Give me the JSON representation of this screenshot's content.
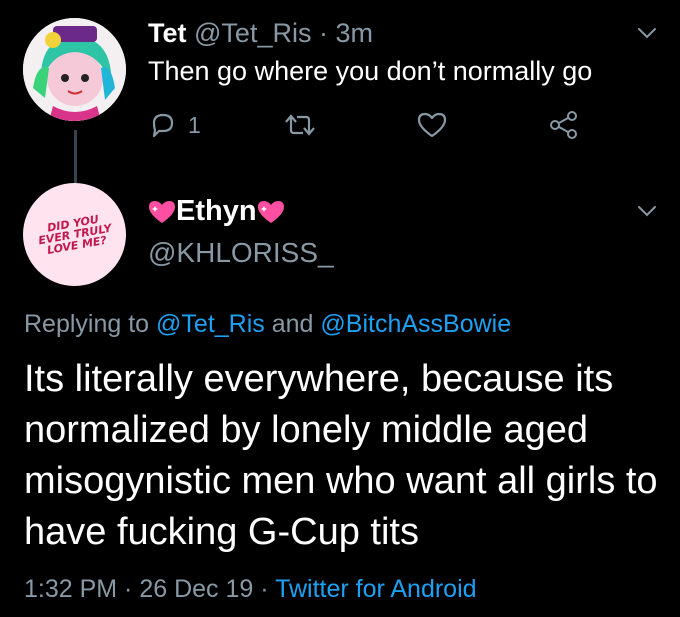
{
  "tweet1": {
    "name": "Tet",
    "handle": "@Tet_Ris",
    "separator": "·",
    "time": "3m",
    "text": "Then go where you don’t normally go",
    "reply_count": "1"
  },
  "tweet2": {
    "name": "Ethyn",
    "handle": "@KHLORISS_",
    "avatar_text": "Did you ever truly love me?",
    "replying_prefix": "Replying to ",
    "replying_user1": "@Tet_Ris",
    "replying_and": " and ",
    "replying_user2": "@BitchAssBowie",
    "body": "Its literally everywhere, because its normalized by lonely middle aged misogynistic men who want all girls to have fucking G-Cup tits",
    "time": "1:32 PM",
    "sep1": " · ",
    "date": "26 Dec 19",
    "sep2": " · ",
    "client": "Twitter for Android"
  },
  "colors": {
    "background": "#000000",
    "muted": "#8899a6",
    "link": "#1da1f2",
    "heart": "#ff4fa3"
  },
  "icons": [
    "chevron-down-icon",
    "reply-icon",
    "retweet-icon",
    "like-icon",
    "share-icon",
    "sparkle-heart-icon"
  ]
}
